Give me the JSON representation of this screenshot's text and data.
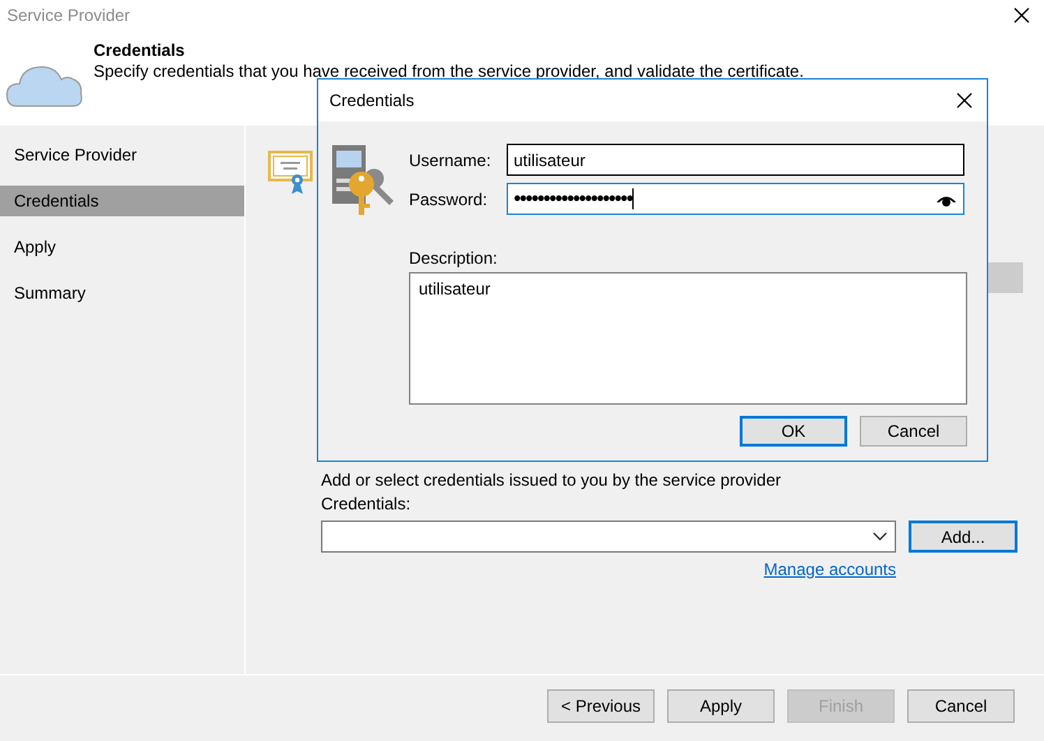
{
  "window": {
    "title": "Service Provider"
  },
  "header": {
    "title": "Credentials",
    "subtitle": "Specify credentials that you have received from the service provider, and validate the certificate."
  },
  "sidebar": {
    "items": [
      {
        "label": "Service Provider",
        "selected": false
      },
      {
        "label": "Credentials",
        "selected": true
      },
      {
        "label": "Apply",
        "selected": false
      },
      {
        "label": "Summary",
        "selected": false
      }
    ]
  },
  "content": {
    "instruction": "Add or select credentials issued to you by the service provider",
    "credentials_label": "Credentials:",
    "add_button": {
      "label": "Add...",
      "focused": true
    },
    "link": "Manage accounts"
  },
  "footer": {
    "buttons": [
      {
        "label": "< Previous",
        "disabled": false
      },
      {
        "label": "Apply",
        "disabled": false
      },
      {
        "label": "Finish",
        "disabled": true
      },
      {
        "label": "Cancel",
        "disabled": false
      }
    ]
  },
  "dialog": {
    "title": "Credentials",
    "username_label": "Username:",
    "username": "utilisateur",
    "password_label": "Password:",
    "password": "••••••••••••••••••••",
    "description_label": "Description:",
    "description": "utilisateur",
    "buttons": [
      {
        "label": "OK",
        "focused": true
      },
      {
        "label": "Cancel",
        "focused": false
      }
    ]
  }
}
